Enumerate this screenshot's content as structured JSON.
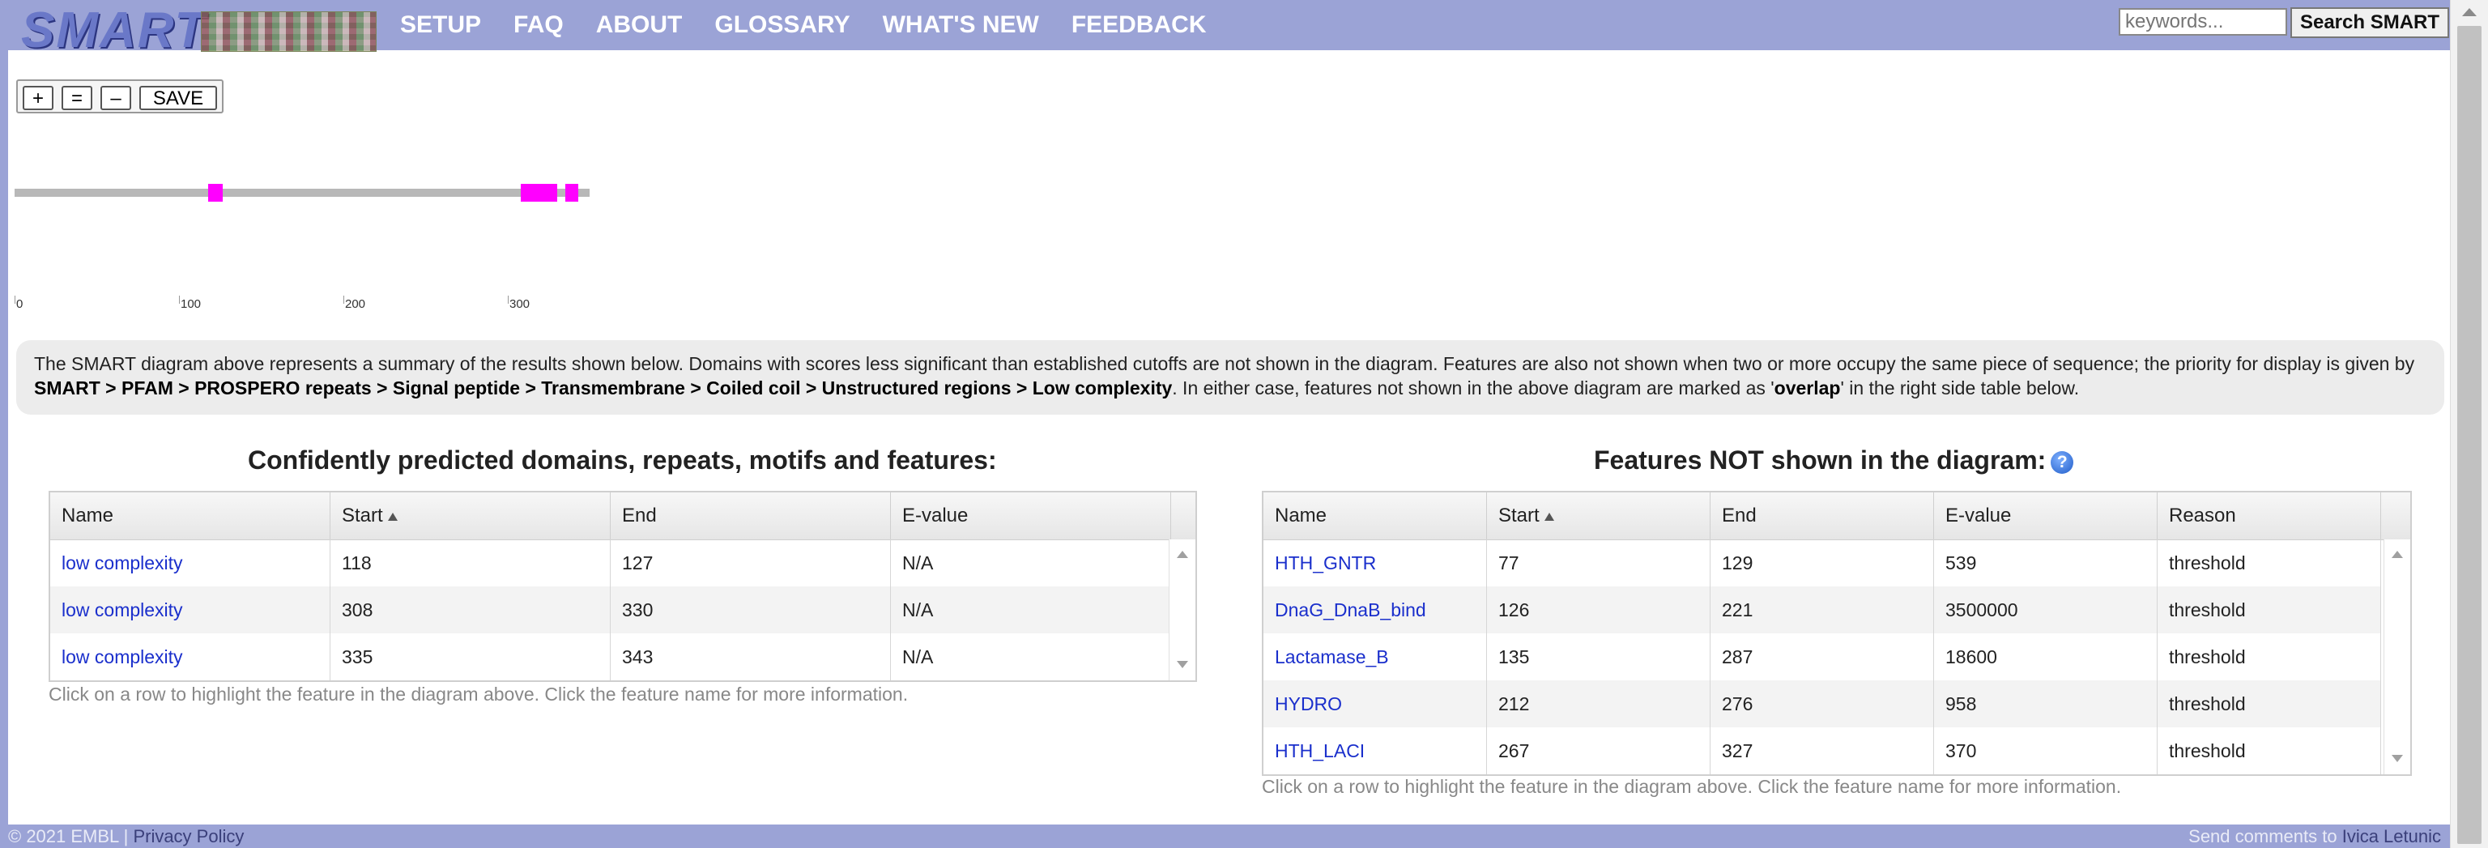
{
  "header": {
    "logo_text": "SMART",
    "nav": [
      "SETUP",
      "FAQ",
      "ABOUT",
      "GLOSSARY",
      "WHAT'S NEW",
      "FEEDBACK"
    ],
    "search_placeholder": "keywords...",
    "search_button": "Search SMART"
  },
  "zoom": {
    "plus": "+",
    "equal": "=",
    "minus": "–",
    "save": "SAVE"
  },
  "diagram": {
    "sequence_length": 350,
    "domain_color": "#ff00ff",
    "features": [
      {
        "start": 118,
        "end": 127
      },
      {
        "start": 308,
        "end": 330
      },
      {
        "start": 335,
        "end": 343
      }
    ],
    "ticks": [
      "0",
      "100",
      "200",
      "300"
    ]
  },
  "info": {
    "part1": "The SMART diagram above represents a summary of the results shown below. Domains with scores less significant than established cutoffs are not shown in the diagram. Features are also not shown when two or more occupy the same piece of sequence; the priority for display is given by ",
    "priority": "SMART > PFAM > PROSPERO repeats > Signal peptide > Transmembrane > Coiled coil > Unstructured regions > Low complexity",
    "part2": ". In either case, features not shown in the above diagram are marked as '",
    "overlap": "overlap",
    "part3": "' in the right side table below."
  },
  "left_table": {
    "title": "Confidently predicted domains, repeats, motifs and features:",
    "columns": [
      "Name",
      "Start",
      "End",
      "E-value"
    ],
    "rows": [
      [
        "low complexity",
        "118",
        "127",
        "N/A"
      ],
      [
        "low complexity",
        "308",
        "330",
        "N/A"
      ],
      [
        "low complexity",
        "335",
        "343",
        "N/A"
      ]
    ],
    "hint": "Click on a row to highlight the feature in the diagram above. Click the feature name for more information."
  },
  "right_table": {
    "title": "Features NOT shown in the diagram:",
    "help": "?",
    "columns": [
      "Name",
      "Start",
      "End",
      "E-value",
      "Reason"
    ],
    "rows": [
      [
        "HTH_GNTR",
        "77",
        "129",
        "539",
        "threshold"
      ],
      [
        "DnaG_DnaB_bind",
        "126",
        "221",
        "3500000",
        "threshold"
      ],
      [
        "Lactamase_B",
        "135",
        "287",
        "18600",
        "threshold"
      ],
      [
        "HYDRO",
        "212",
        "276",
        "958",
        "threshold"
      ],
      [
        "HTH_LACI",
        "267",
        "327",
        "370",
        "threshold"
      ]
    ],
    "hint": "Click on a row to highlight the feature in the diagram above. Click the feature name for more information."
  },
  "footer": {
    "copyright": "© 2021 EMBL",
    "separator": "|",
    "privacy": "Privacy Policy",
    "comments": "Send comments to",
    "author": "Ivica Letunic"
  }
}
